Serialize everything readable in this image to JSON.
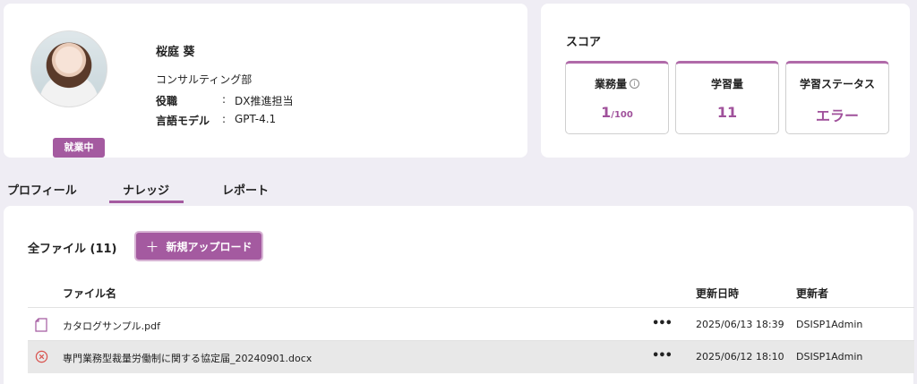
{
  "profile": {
    "name": "桜庭 葵",
    "status_badge": "就業中",
    "department": "コンサルティング部",
    "role_label": "役職",
    "role_value": "DX推進担当",
    "model_label": "言語モデル",
    "model_value": "GPT-4.1",
    "separator": ":"
  },
  "score": {
    "title": "スコア",
    "tasks": {
      "label": "業務量",
      "value": "1",
      "suffix": "/100",
      "icon": "info-icon"
    },
    "learning": {
      "label": "学習量",
      "value": "11"
    },
    "learning_status": {
      "label": "学習ステータス",
      "value": "エラー"
    },
    "accent_color": "#a0519b"
  },
  "tabs": [
    {
      "label": "プロフィール",
      "active": false
    },
    {
      "label": "ナレッジ",
      "active": true
    },
    {
      "label": "レポート",
      "active": false
    }
  ],
  "files": {
    "title": "全ファイル (11)",
    "upload_button": "新規アップロード",
    "columns": {
      "name": "ファイル名",
      "date": "更新日時",
      "user": "更新者"
    },
    "rows": [
      {
        "icon": "document-icon",
        "name": "カタログサンプル.pdf",
        "more": "•••",
        "date": "2025/06/13 18:39",
        "user": "DSISP1Admin"
      },
      {
        "icon": "error-circle-icon",
        "name": "専門業務型裁量労働制に関する協定届_20240901.docx",
        "more": "•••",
        "date": "2025/06/12 18:10",
        "user": "DSISP1Admin"
      }
    ]
  }
}
